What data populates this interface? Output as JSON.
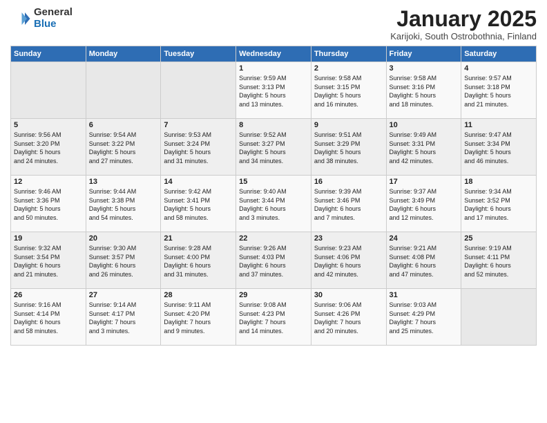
{
  "logo": {
    "general": "General",
    "blue": "Blue"
  },
  "title": "January 2025",
  "subtitle": "Karijoki, South Ostrobothnia, Finland",
  "days_of_week": [
    "Sunday",
    "Monday",
    "Tuesday",
    "Wednesday",
    "Thursday",
    "Friday",
    "Saturday"
  ],
  "weeks": [
    [
      {
        "day": "",
        "info": ""
      },
      {
        "day": "",
        "info": ""
      },
      {
        "day": "",
        "info": ""
      },
      {
        "day": "1",
        "info": "Sunrise: 9:59 AM\nSunset: 3:13 PM\nDaylight: 5 hours\nand 13 minutes."
      },
      {
        "day": "2",
        "info": "Sunrise: 9:58 AM\nSunset: 3:15 PM\nDaylight: 5 hours\nand 16 minutes."
      },
      {
        "day": "3",
        "info": "Sunrise: 9:58 AM\nSunset: 3:16 PM\nDaylight: 5 hours\nand 18 minutes."
      },
      {
        "day": "4",
        "info": "Sunrise: 9:57 AM\nSunset: 3:18 PM\nDaylight: 5 hours\nand 21 minutes."
      }
    ],
    [
      {
        "day": "5",
        "info": "Sunrise: 9:56 AM\nSunset: 3:20 PM\nDaylight: 5 hours\nand 24 minutes."
      },
      {
        "day": "6",
        "info": "Sunrise: 9:54 AM\nSunset: 3:22 PM\nDaylight: 5 hours\nand 27 minutes."
      },
      {
        "day": "7",
        "info": "Sunrise: 9:53 AM\nSunset: 3:24 PM\nDaylight: 5 hours\nand 31 minutes."
      },
      {
        "day": "8",
        "info": "Sunrise: 9:52 AM\nSunset: 3:27 PM\nDaylight: 5 hours\nand 34 minutes."
      },
      {
        "day": "9",
        "info": "Sunrise: 9:51 AM\nSunset: 3:29 PM\nDaylight: 5 hours\nand 38 minutes."
      },
      {
        "day": "10",
        "info": "Sunrise: 9:49 AM\nSunset: 3:31 PM\nDaylight: 5 hours\nand 42 minutes."
      },
      {
        "day": "11",
        "info": "Sunrise: 9:47 AM\nSunset: 3:34 PM\nDaylight: 5 hours\nand 46 minutes."
      }
    ],
    [
      {
        "day": "12",
        "info": "Sunrise: 9:46 AM\nSunset: 3:36 PM\nDaylight: 5 hours\nand 50 minutes."
      },
      {
        "day": "13",
        "info": "Sunrise: 9:44 AM\nSunset: 3:38 PM\nDaylight: 5 hours\nand 54 minutes."
      },
      {
        "day": "14",
        "info": "Sunrise: 9:42 AM\nSunset: 3:41 PM\nDaylight: 5 hours\nand 58 minutes."
      },
      {
        "day": "15",
        "info": "Sunrise: 9:40 AM\nSunset: 3:44 PM\nDaylight: 6 hours\nand 3 minutes."
      },
      {
        "day": "16",
        "info": "Sunrise: 9:39 AM\nSunset: 3:46 PM\nDaylight: 6 hours\nand 7 minutes."
      },
      {
        "day": "17",
        "info": "Sunrise: 9:37 AM\nSunset: 3:49 PM\nDaylight: 6 hours\nand 12 minutes."
      },
      {
        "day": "18",
        "info": "Sunrise: 9:34 AM\nSunset: 3:52 PM\nDaylight: 6 hours\nand 17 minutes."
      }
    ],
    [
      {
        "day": "19",
        "info": "Sunrise: 9:32 AM\nSunset: 3:54 PM\nDaylight: 6 hours\nand 21 minutes."
      },
      {
        "day": "20",
        "info": "Sunrise: 9:30 AM\nSunset: 3:57 PM\nDaylight: 6 hours\nand 26 minutes."
      },
      {
        "day": "21",
        "info": "Sunrise: 9:28 AM\nSunset: 4:00 PM\nDaylight: 6 hours\nand 31 minutes."
      },
      {
        "day": "22",
        "info": "Sunrise: 9:26 AM\nSunset: 4:03 PM\nDaylight: 6 hours\nand 37 minutes."
      },
      {
        "day": "23",
        "info": "Sunrise: 9:23 AM\nSunset: 4:06 PM\nDaylight: 6 hours\nand 42 minutes."
      },
      {
        "day": "24",
        "info": "Sunrise: 9:21 AM\nSunset: 4:08 PM\nDaylight: 6 hours\nand 47 minutes."
      },
      {
        "day": "25",
        "info": "Sunrise: 9:19 AM\nSunset: 4:11 PM\nDaylight: 6 hours\nand 52 minutes."
      }
    ],
    [
      {
        "day": "26",
        "info": "Sunrise: 9:16 AM\nSunset: 4:14 PM\nDaylight: 6 hours\nand 58 minutes."
      },
      {
        "day": "27",
        "info": "Sunrise: 9:14 AM\nSunset: 4:17 PM\nDaylight: 7 hours\nand 3 minutes."
      },
      {
        "day": "28",
        "info": "Sunrise: 9:11 AM\nSunset: 4:20 PM\nDaylight: 7 hours\nand 9 minutes."
      },
      {
        "day": "29",
        "info": "Sunrise: 9:08 AM\nSunset: 4:23 PM\nDaylight: 7 hours\nand 14 minutes."
      },
      {
        "day": "30",
        "info": "Sunrise: 9:06 AM\nSunset: 4:26 PM\nDaylight: 7 hours\nand 20 minutes."
      },
      {
        "day": "31",
        "info": "Sunrise: 9:03 AM\nSunset: 4:29 PM\nDaylight: 7 hours\nand 25 minutes."
      },
      {
        "day": "",
        "info": ""
      }
    ]
  ]
}
